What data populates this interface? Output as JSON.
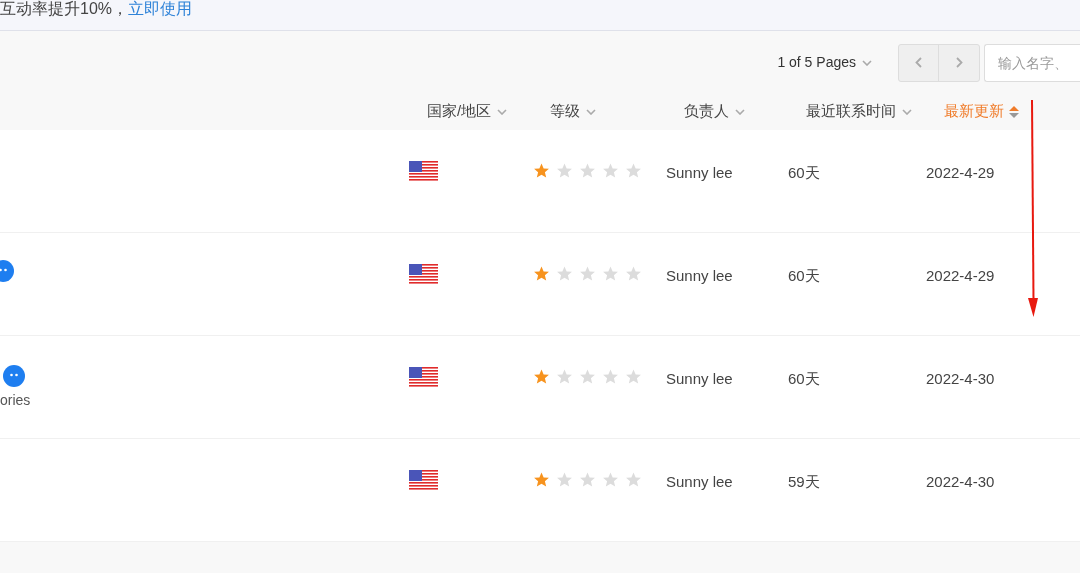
{
  "banner": {
    "text": "互动率提升10%，",
    "link": "立即使用"
  },
  "pagination": {
    "label": "1 of 5 Pages"
  },
  "search": {
    "placeholder": "输入名字、"
  },
  "columns": [
    {
      "label": "国家/地区",
      "sorted": false
    },
    {
      "label": "等级",
      "sorted": false
    },
    {
      "label": "负责人",
      "sorted": false
    },
    {
      "label": "最近联系时间",
      "sorted": false
    },
    {
      "label": "最新更新",
      "sorted": true
    }
  ],
  "rows": [
    {
      "chat": false,
      "stars": 1,
      "owner": "Sunny lee",
      "last_contact": "60天",
      "updated": "2022-4-29"
    },
    {
      "chat": true,
      "stars": 1,
      "owner": "Sunny lee",
      "last_contact": "60天",
      "updated": "2022-4-29"
    },
    {
      "chat": true,
      "note": "ories",
      "stars": 1,
      "owner": "Sunny lee",
      "last_contact": "60天",
      "updated": "2022-4-30"
    },
    {
      "chat": false,
      "stars": 1,
      "owner": "Sunny lee",
      "last_contact": "59天",
      "updated": "2022-4-30"
    }
  ]
}
